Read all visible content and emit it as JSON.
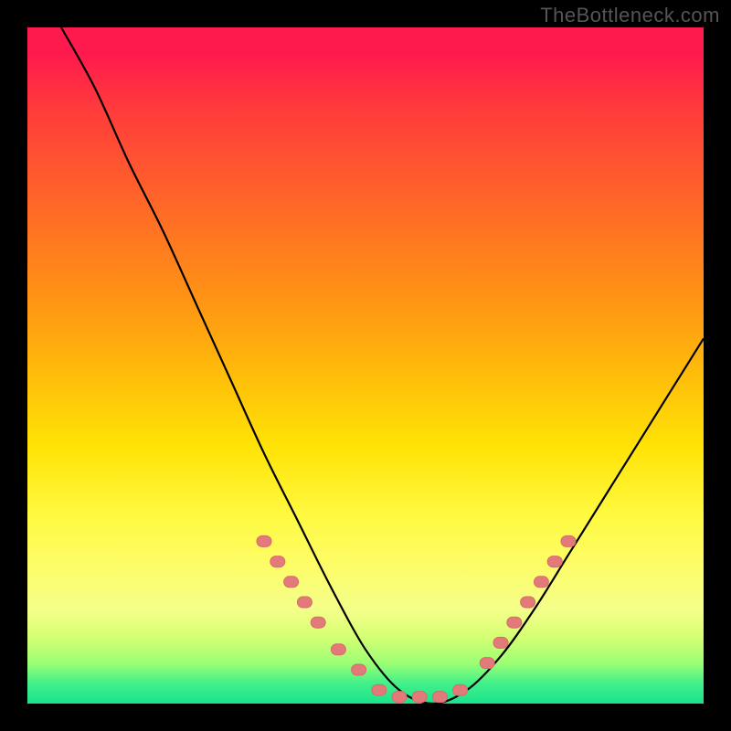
{
  "watermark": "TheBottleneck.com",
  "colors": {
    "frame": "#000000",
    "curve_stroke": "#000000",
    "marker_fill": "#e37a7a",
    "marker_stroke": "#d96a6a"
  },
  "chart_data": {
    "type": "line",
    "title": "",
    "xlabel": "",
    "ylabel": "",
    "xlim": [
      0,
      100
    ],
    "ylim": [
      0,
      100
    ],
    "grid": false,
    "legend": false,
    "description": "Single asymmetric V-shaped curve (bottleneck profile). Steep descending left arm from top-left, rounded minimum near x≈55, shallower ascending right arm ending near mid-height at right edge. Salmon dot markers cluster along the lower portions of both arms and across the valley.",
    "series": [
      {
        "name": "bottleneck-curve",
        "x": [
          5,
          10,
          15,
          20,
          25,
          30,
          35,
          40,
          45,
          50,
          55,
          60,
          65,
          70,
          75,
          80,
          85,
          90,
          95,
          100
        ],
        "y": [
          100,
          91,
          80,
          70,
          59,
          48,
          37,
          27,
          17,
          8,
          2,
          0,
          2,
          7,
          14,
          22,
          30,
          38,
          46,
          54
        ]
      }
    ],
    "markers": {
      "note": "Salmon rounded-rect markers plotted along the curve in the low region (roughly y < 25).",
      "x": [
        35,
        37,
        39,
        41,
        43,
        46,
        49,
        52,
        55,
        58,
        61,
        64,
        68,
        70,
        72,
        74,
        76,
        78,
        80
      ],
      "y": [
        24,
        21,
        18,
        15,
        12,
        8,
        5,
        2,
        1,
        1,
        1,
        2,
        6,
        9,
        12,
        15,
        18,
        21,
        24
      ]
    }
  }
}
